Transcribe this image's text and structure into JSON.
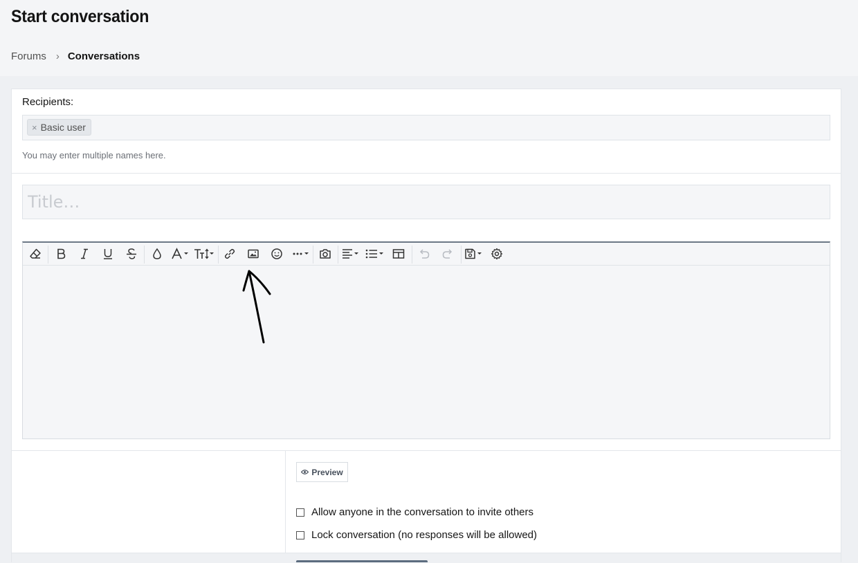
{
  "page": {
    "title": "Start conversation"
  },
  "breadcrumb": {
    "items": [
      "Forums"
    ],
    "separator": "›",
    "current": "Conversations"
  },
  "recipients": {
    "label": "Recipients:",
    "tokens": [
      {
        "remove_glyph": "×",
        "label": "Basic user"
      }
    ],
    "hint": "You may enter multiple names here."
  },
  "title_field": {
    "placeholder": "Title…",
    "value": ""
  },
  "editor": {
    "toolbar_icons": [
      "remove-format-icon",
      "bold-icon",
      "italic-icon",
      "underline-icon",
      "strikethrough-icon",
      "text-color-icon",
      "font-family-icon",
      "font-size-icon",
      "insert-link-icon",
      "insert-image-icon",
      "smilies-icon",
      "more-options-icon",
      "media-icon",
      "alignment-icon",
      "list-icon",
      "table-icon",
      "undo-icon",
      "redo-icon",
      "drafts-icon",
      "settings-icon"
    ],
    "body": ""
  },
  "footer": {
    "preview_label": "Preview",
    "options": [
      {
        "label": "Allow anyone in the conversation to invite others",
        "checked": false
      },
      {
        "label": "Lock conversation (no responses will be allowed)",
        "checked": false
      }
    ]
  },
  "colors": {
    "page_bg": "#eef0f3",
    "panel_bg": "#ffffff",
    "field_bg": "#f5f6f8",
    "accent": "#5b6b7e",
    "text": "#141414"
  }
}
